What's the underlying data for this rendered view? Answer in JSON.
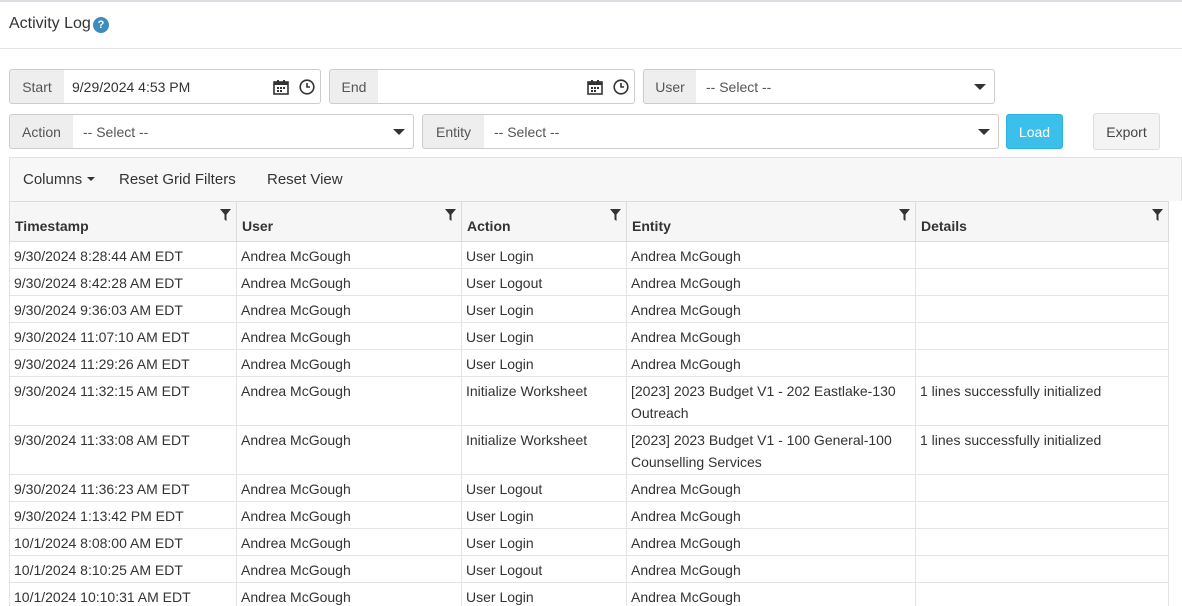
{
  "header": {
    "title": "Activity Log",
    "help_icon": "?"
  },
  "filters": {
    "start_label": "Start",
    "start_value": "9/29/2024 4:53 PM",
    "end_label": "End",
    "end_value": "",
    "user_label": "User",
    "user_placeholder": "-- Select --",
    "action_label": "Action",
    "action_placeholder": "-- Select --",
    "entity_label": "Entity",
    "entity_placeholder": "-- Select --",
    "load_label": "Load",
    "export_label": "Export",
    "load_color": "#3bc0ec"
  },
  "toolbar": {
    "columns_label": "Columns",
    "reset_filters_label": "Reset Grid Filters",
    "reset_view_label": "Reset View"
  },
  "grid": {
    "columns": [
      "Timestamp",
      "User",
      "Action",
      "Entity",
      "Details"
    ],
    "rows": [
      [
        "9/30/2024 8:28:44 AM EDT",
        "Andrea McGough",
        "User Login",
        "Andrea McGough",
        ""
      ],
      [
        "9/30/2024 8:42:28 AM EDT",
        "Andrea McGough",
        "User Logout",
        "Andrea McGough",
        ""
      ],
      [
        "9/30/2024 9:36:03 AM EDT",
        "Andrea McGough",
        "User Login",
        "Andrea McGough",
        ""
      ],
      [
        "9/30/2024 11:07:10 AM EDT",
        "Andrea McGough",
        "User Login",
        "Andrea McGough",
        ""
      ],
      [
        "9/30/2024 11:29:26 AM EDT",
        "Andrea McGough",
        "User Login",
        "Andrea McGough",
        ""
      ],
      [
        "9/30/2024 11:32:15 AM EDT",
        "Andrea McGough",
        "Initialize Worksheet",
        "[2023] 2023 Budget V1 - 202 Eastlake-130 Outreach",
        "1 lines successfully initialized"
      ],
      [
        "9/30/2024 11:33:08 AM EDT",
        "Andrea McGough",
        "Initialize Worksheet",
        "[2023] 2023 Budget V1 - 100 General-100 Counselling Services",
        "1 lines successfully initialized"
      ],
      [
        "9/30/2024 11:36:23 AM EDT",
        "Andrea McGough",
        "User Logout",
        "Andrea McGough",
        ""
      ],
      [
        "9/30/2024 1:13:42 PM EDT",
        "Andrea McGough",
        "User Login",
        "Andrea McGough",
        ""
      ],
      [
        "10/1/2024 8:08:00 AM EDT",
        "Andrea McGough",
        "User Login",
        "Andrea McGough",
        ""
      ],
      [
        "10/1/2024 8:10:25 AM EDT",
        "Andrea McGough",
        "User Logout",
        "Andrea McGough",
        ""
      ],
      [
        "10/1/2024 10:10:31 AM EDT",
        "Andrea McGough",
        "User Login",
        "Andrea McGough",
        ""
      ]
    ]
  }
}
